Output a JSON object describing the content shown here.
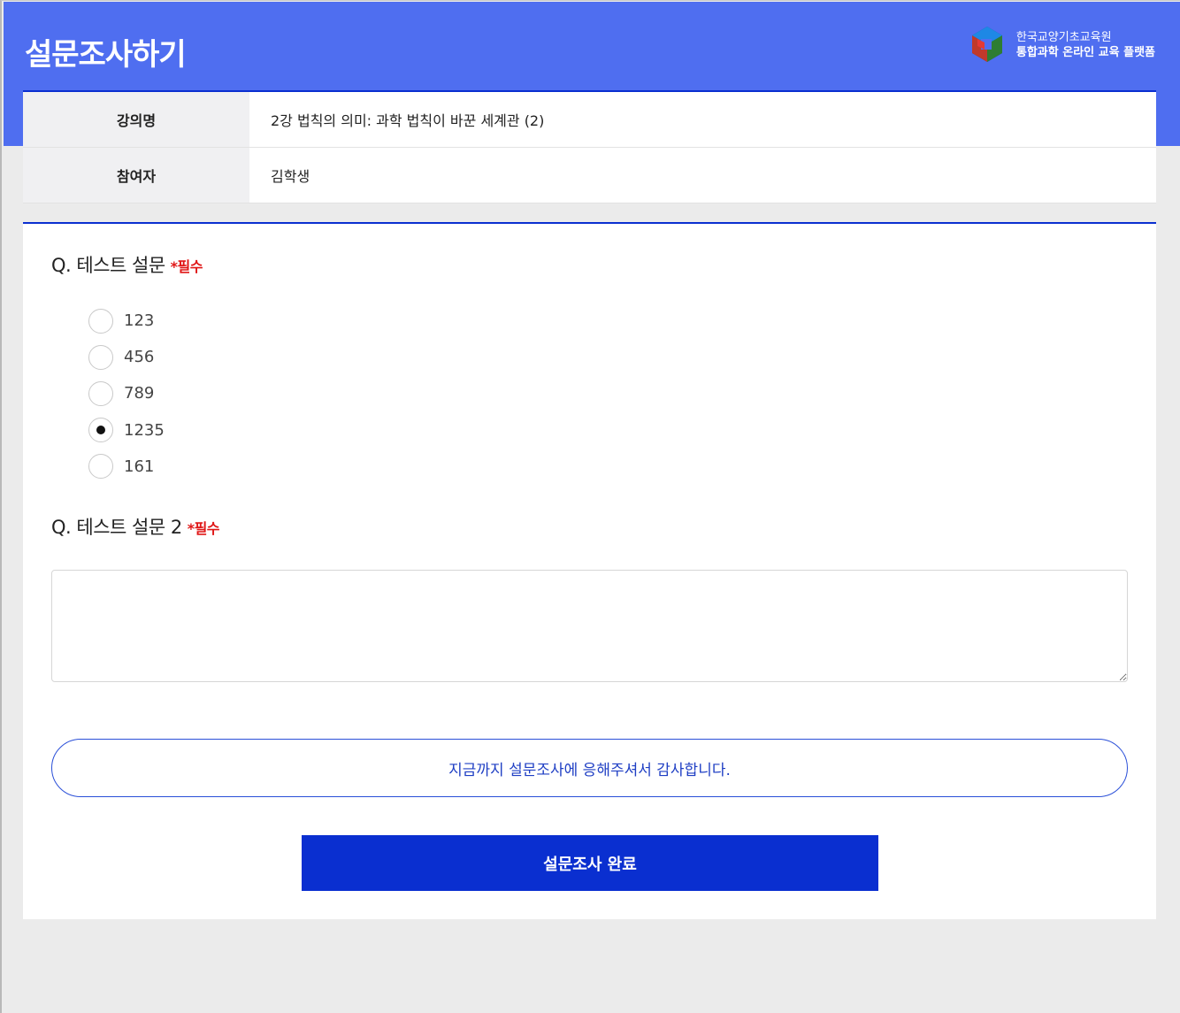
{
  "header": {
    "title": "설문조사하기",
    "brand_line1": "한국교양기초교육원",
    "brand_line2": "통합과학 온라인 교육 플랫폼"
  },
  "info": {
    "lecture_label": "강의명",
    "lecture_value": "2강 법칙의 의미: 과학 법칙이 바꾼 세계관 (2)",
    "participant_label": "참여자",
    "participant_value": "김학생"
  },
  "questions": [
    {
      "title": "Q. 테스트 설문",
      "required": "*필수",
      "options": [
        "123",
        "456",
        "789",
        "1235",
        "161"
      ],
      "selected_index": 3
    },
    {
      "title": "Q. 테스트 설문 2",
      "required": "*필수",
      "answer": "",
      "placeholder": ""
    }
  ],
  "thanks_message": "지금까지 설문조사에 응해주셔서 감사합니다.",
  "submit_label": "설문조사 완료",
  "colors": {
    "header_bg": "#4f6ef0",
    "accent": "#0a2fd0",
    "required": "#e01616"
  }
}
